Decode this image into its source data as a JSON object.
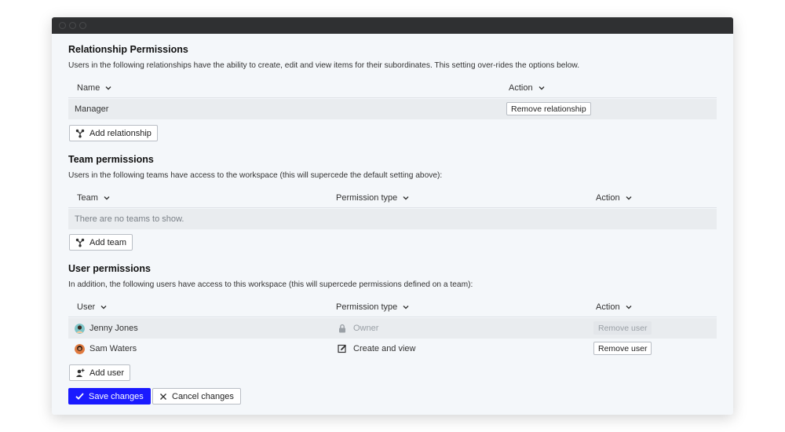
{
  "relationship": {
    "title": "Relationship Permissions",
    "description": "Users in the following relationships have the ability to create, edit and view items for their subordinates. This setting over-rides the options below.",
    "columns": {
      "name": "Name",
      "action": "Action"
    },
    "rows": [
      {
        "name": "Manager",
        "action": "Remove relationship"
      }
    ],
    "add_label": "Add relationship"
  },
  "team": {
    "title": "Team permissions",
    "description": "Users in the following teams have access to the workspace (this will supercede the default setting above):",
    "columns": {
      "team": "Team",
      "permission": "Permission type",
      "action": "Action"
    },
    "empty_text": "There are no teams to show.",
    "add_label": "Add team"
  },
  "user": {
    "title": "User permissions",
    "description": "In addition, the following users have access to this workspace (this will supercede permissions defined on a team):",
    "columns": {
      "user": "User",
      "permission": "Permission type",
      "action": "Action"
    },
    "rows": [
      {
        "name": "Jenny Jones",
        "permission": "Owner",
        "permission_icon": "lock-icon",
        "action": "Remove user",
        "action_disabled": true
      },
      {
        "name": "Sam Waters",
        "permission": "Create and view",
        "permission_icon": "edit-icon",
        "action": "Remove user",
        "action_disabled": false
      }
    ],
    "add_label": "Add user"
  },
  "footer": {
    "save_label": "Save changes",
    "cancel_label": "Cancel changes"
  },
  "colors": {
    "primary": "#1a1aff",
    "panel": "#f4f7fa",
    "titlebar": "#2f3032"
  }
}
